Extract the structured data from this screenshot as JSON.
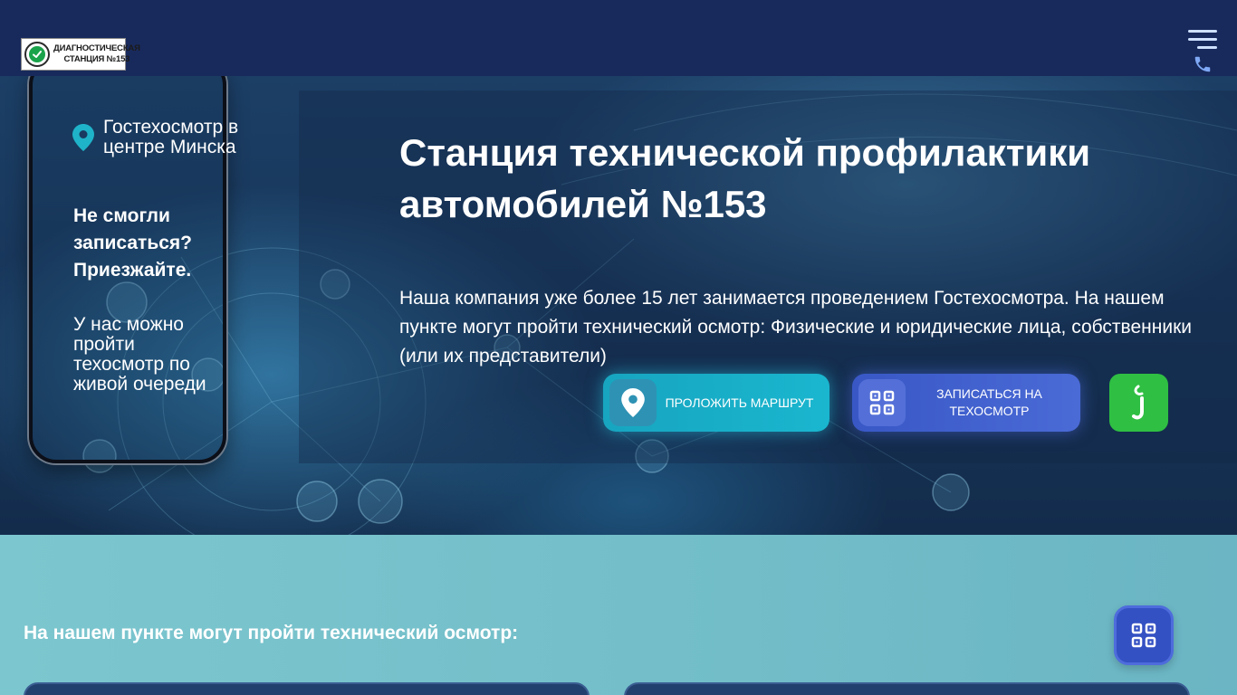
{
  "header": {
    "logo_line1": "ДИАГНОСТИЧЕСКАЯ",
    "logo_line2": "СТАНЦИЯ №153"
  },
  "phone": {
    "location_label": "Гостехосмотр в центре Минска",
    "note_bold": "Не смогли записаться? Приезжайте.",
    "note": "У нас можно пройти техосмотр по живой очереди"
  },
  "hero": {
    "title": "Станция технической профилактики автомобилей №153",
    "description": "Наша компания уже более 15 лет занимается проведением Гостехосмотра. На нашем пункте могут пройти технический осмотр: Физические и юридические лица, собственники (или их представители)"
  },
  "buttons": {
    "route_label": "ПРОЛОЖИТЬ МАРШРУТ",
    "book_label": "ЗАПИСАТЬСЯ НА ТЕХОСМОТР"
  },
  "lower": {
    "title": "На нашем пункте могут пройти технический осмотр:"
  },
  "colors": {
    "header": "#182a5c",
    "route_button": "#1ab6cf",
    "book_button": "#4a6ad6",
    "green_button": "#2fbf43",
    "lower_section": "#76c3cb"
  },
  "icons": [
    "check-icon",
    "menu-icon",
    "phone-icon",
    "location-pin-icon",
    "qr-code-icon",
    "green-app-icon"
  ]
}
